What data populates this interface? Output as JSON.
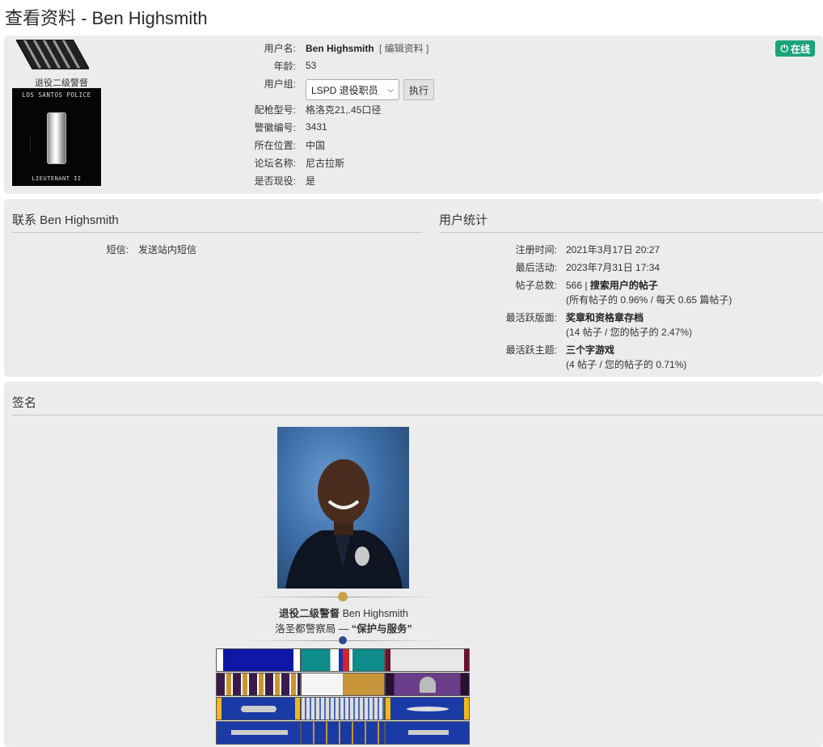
{
  "page_title": "查看资料 - Ben Highsmith",
  "profile": {
    "rank_title": "退役二级警督",
    "badge_top_text": "LOS SANTOS POLICE",
    "badge_bottom_text": "LIEUTENANT II",
    "online_label": "在线",
    "rows": [
      {
        "label": "用户名:",
        "value": "Ben Highsmith",
        "extra": "[ 编辑资料 ]"
      },
      {
        "label": "年龄:",
        "value": "53"
      },
      {
        "label": "用户组:",
        "value": "LSPD 退役职员",
        "button": "执行"
      },
      {
        "label": "配枪型号:",
        "value": "格洛克21,.45口径"
      },
      {
        "label": "警徽编号:",
        "value": "3431"
      },
      {
        "label": "所在位置:",
        "value": "中国"
      },
      {
        "label": "论坛名称:",
        "value": "尼古拉斯"
      },
      {
        "label": "是否现役:",
        "value": "是"
      }
    ]
  },
  "contact": {
    "heading": "联系 Ben Highsmith",
    "pm_label": "短信:",
    "pm_link": "发送站内短信"
  },
  "stats": {
    "heading": "用户统计",
    "joined_label": "注册时间:",
    "joined_value": "2021年3月17日 20:27",
    "last_active_label": "最后活动:",
    "last_active_value": "2023年7月31日 17:34",
    "posts_label": "帖子总数:",
    "posts_count": "566",
    "posts_sep": "|",
    "posts_search": "搜索用户的帖子",
    "posts_detail": "(所有帖子的 0.96% / 每天 0.65 篇帖子)",
    "active_forum_label": "最活跃版面:",
    "active_forum_value": "奖章和资格章存档",
    "active_forum_detail": "(14 帖子 / 您的帖子的 2.47%)",
    "active_topic_label": "最活跃主题:",
    "active_topic_value": "三个字游戏",
    "active_topic_detail": "(4 帖子 / 您的帖子的 0.71%)"
  },
  "signature": {
    "heading": "签名",
    "line1_rank": "退役二级警督",
    "line1_name": "Ben Highsmith",
    "line2_dept": "洛圣都警察局 —",
    "line2_motto": "“保护与服务”"
  }
}
